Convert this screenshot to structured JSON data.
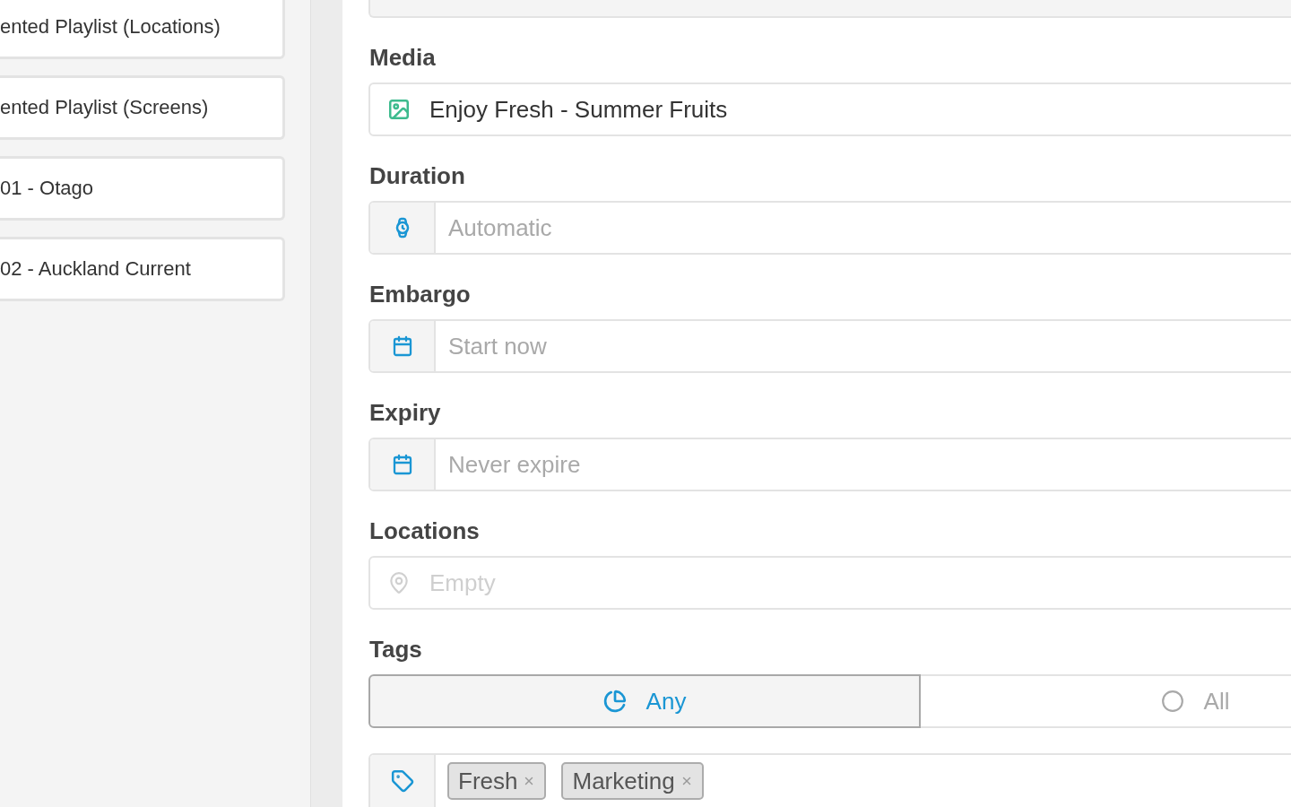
{
  "sidebar": {
    "items": [
      {
        "label": "ented Playlist (Locations)"
      },
      {
        "label": "ented Playlist (Screens)"
      },
      {
        "label": "01 - Otago"
      },
      {
        "label": "02 - Auckland Current"
      }
    ]
  },
  "form": {
    "fields": [
      {
        "kind": "media",
        "label": "Media",
        "value": "Enjoy Fresh - Summer Fruits"
      },
      {
        "kind": "duration",
        "label": "Duration",
        "placeholder": "Automatic"
      },
      {
        "kind": "date",
        "label": "Embargo",
        "placeholder": "Start now"
      },
      {
        "kind": "date",
        "label": "Expiry",
        "placeholder": "Never expire"
      },
      {
        "kind": "location",
        "label": "Locations",
        "placeholder": "Empty",
        "disabled": true
      }
    ],
    "tags": {
      "label": "Tags",
      "match": [
        {
          "kind": "partial",
          "label": "Any",
          "selected": true
        },
        {
          "kind": "full",
          "label": "All",
          "selected": false
        }
      ],
      "chips": [
        {
          "label": "Fresh"
        },
        {
          "label": "Marketing"
        }
      ]
    }
  }
}
